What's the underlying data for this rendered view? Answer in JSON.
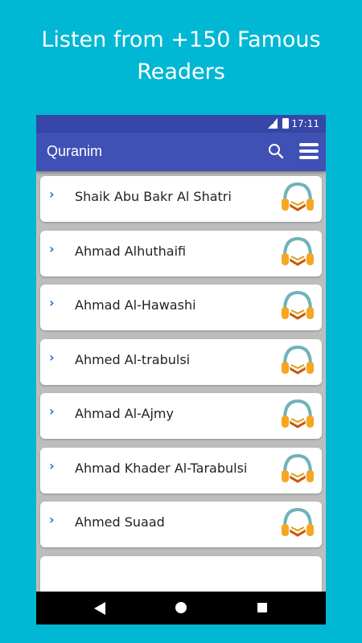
{
  "promo": {
    "line1": "Listen from +150 Famous",
    "line2": "Readers"
  },
  "status_bar": {
    "time": "17:11"
  },
  "app_bar": {
    "title": "Quranim",
    "search_icon": "search-icon",
    "menu_icon": "hamburger-menu-icon"
  },
  "readers": [
    {
      "name": "Shaik Abu Bakr Al Shatri"
    },
    {
      "name": "Ahmad Alhuthaifi"
    },
    {
      "name": "Ahmad Al-Hawashi"
    },
    {
      "name": "Ahmed Al-trabulsi"
    },
    {
      "name": "Ahmad Al-Ajmy"
    },
    {
      "name": "Ahmad Khader Al-Tarabulsi"
    },
    {
      "name": "Ahmed Suaad"
    }
  ],
  "colors": {
    "background": "#00b7d4",
    "app_bar": "#3f51b5",
    "status_bar": "#3647a8",
    "chevron": "#2a6fd6"
  }
}
